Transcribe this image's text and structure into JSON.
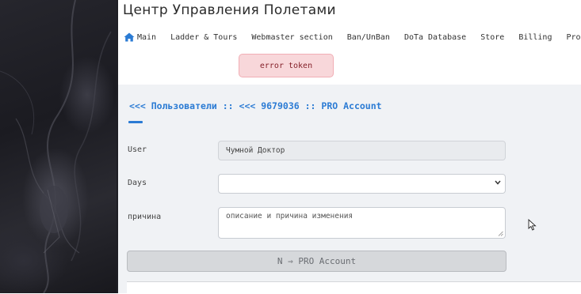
{
  "header": {
    "title": "Центр Управления Полетами"
  },
  "nav": {
    "items": [
      {
        "label": "Main",
        "icon": "home-icon"
      },
      {
        "label": "Ladder & Tours"
      },
      {
        "label": "Webmaster section"
      },
      {
        "label": "Ban/UnBan"
      },
      {
        "label": "DoTa Database"
      },
      {
        "label": "Store"
      },
      {
        "label": "Billing"
      },
      {
        "label": "Pro"
      }
    ]
  },
  "alert": {
    "text": "error token",
    "color": "#842029",
    "background": "#f8d7da"
  },
  "breadcrumb": {
    "users_link": "<<< Пользователи",
    "separator": "::",
    "user_link": "<<< 9679036",
    "current": "PRO Account",
    "color": "#2b7bd4"
  },
  "form": {
    "user": {
      "label": "User",
      "value": "Чумной Доктор"
    },
    "days": {
      "label": "Days",
      "value": ""
    },
    "reason": {
      "label": "причина",
      "placeholder": "описание и причина изменения"
    },
    "submit_label": "N ⇒ PRO Account"
  }
}
